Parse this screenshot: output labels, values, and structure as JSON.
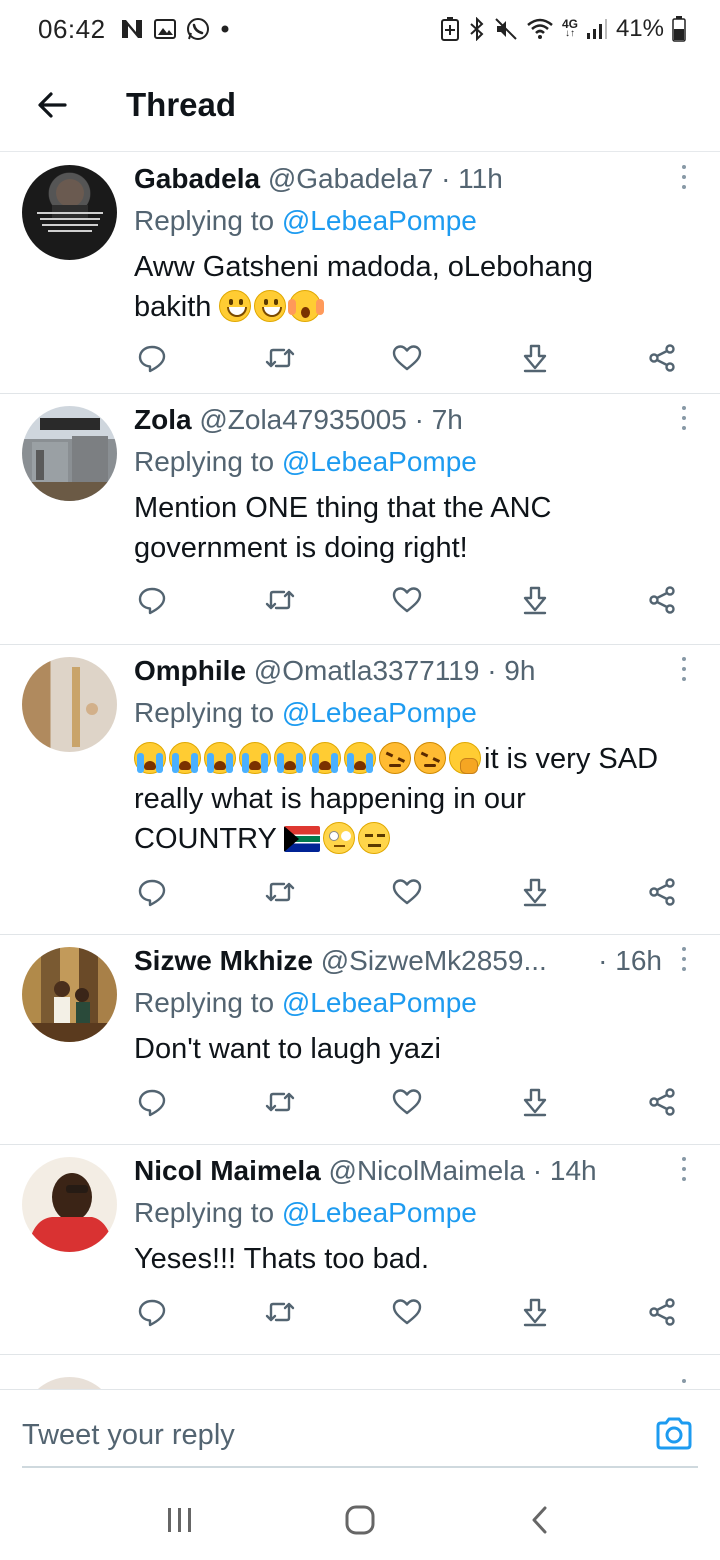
{
  "status_bar": {
    "time": "06:42",
    "left_icons": [
      "network-n-icon",
      "gallery-icon",
      "whatsapp-icon",
      "dot-icon"
    ],
    "right_icons": [
      "battery-saver-icon",
      "bluetooth-icon",
      "mute-icon",
      "wifi-icon",
      "network-4g-icon",
      "signal-icon"
    ],
    "network_label": "4G",
    "battery": "41%"
  },
  "header": {
    "title": "Thread",
    "back_icon": "arrow-left-icon"
  },
  "thread": {
    "tweets": [
      {
        "display_name": "Gabadela",
        "handle": "@Gabadela7",
        "separator": "·",
        "time": "11h",
        "reply_prefix": "Replying to",
        "reply_to": "@LebeaPompe",
        "text": "Aww Gatsheni madoda, oLebohang bakith"
      },
      {
        "display_name": "Zola",
        "handle": "@Zola47935005",
        "separator": "·",
        "time": "7h",
        "reply_prefix": "Replying to",
        "reply_to": "@LebeaPompe",
        "text": "Mention ONE thing that the ANC government is doing right!"
      },
      {
        "display_name": "Omphile",
        "handle": "@Omatla3377119",
        "separator": "·",
        "time": "9h",
        "reply_prefix": "Replying to",
        "reply_to": "@LebeaPompe",
        "text_part1": "it is very SAD really what is  happening in our COUNTRY"
      },
      {
        "display_name": "Sizwe Mkhize",
        "handle": "@SizweMk2859...",
        "separator": "·",
        "time": "16h",
        "reply_prefix": "Replying to",
        "reply_to": "@LebeaPompe",
        "text": "Don't want to laugh yazi"
      },
      {
        "display_name": "Nicol Maimela",
        "handle": "@NicolMaimela",
        "separator": "·",
        "time": "14h",
        "reply_prefix": "Replying to",
        "reply_to": "@LebeaPompe",
        "text": "Yeses!!! Thats too bad."
      }
    ],
    "action_icons": [
      "reply-icon",
      "retweet-icon",
      "like-icon",
      "download-icon",
      "share-icon"
    ]
  },
  "composer": {
    "placeholder": "Tweet your reply",
    "camera_icon": "camera-icon"
  },
  "nav_bar": {
    "icons": [
      "recent-apps-icon",
      "home-icon",
      "back-icon"
    ]
  },
  "colors": {
    "link": "#1d9bf0",
    "text_primary": "#0f1419",
    "text_secondary": "#536471",
    "divider": "#e1e5e8"
  }
}
